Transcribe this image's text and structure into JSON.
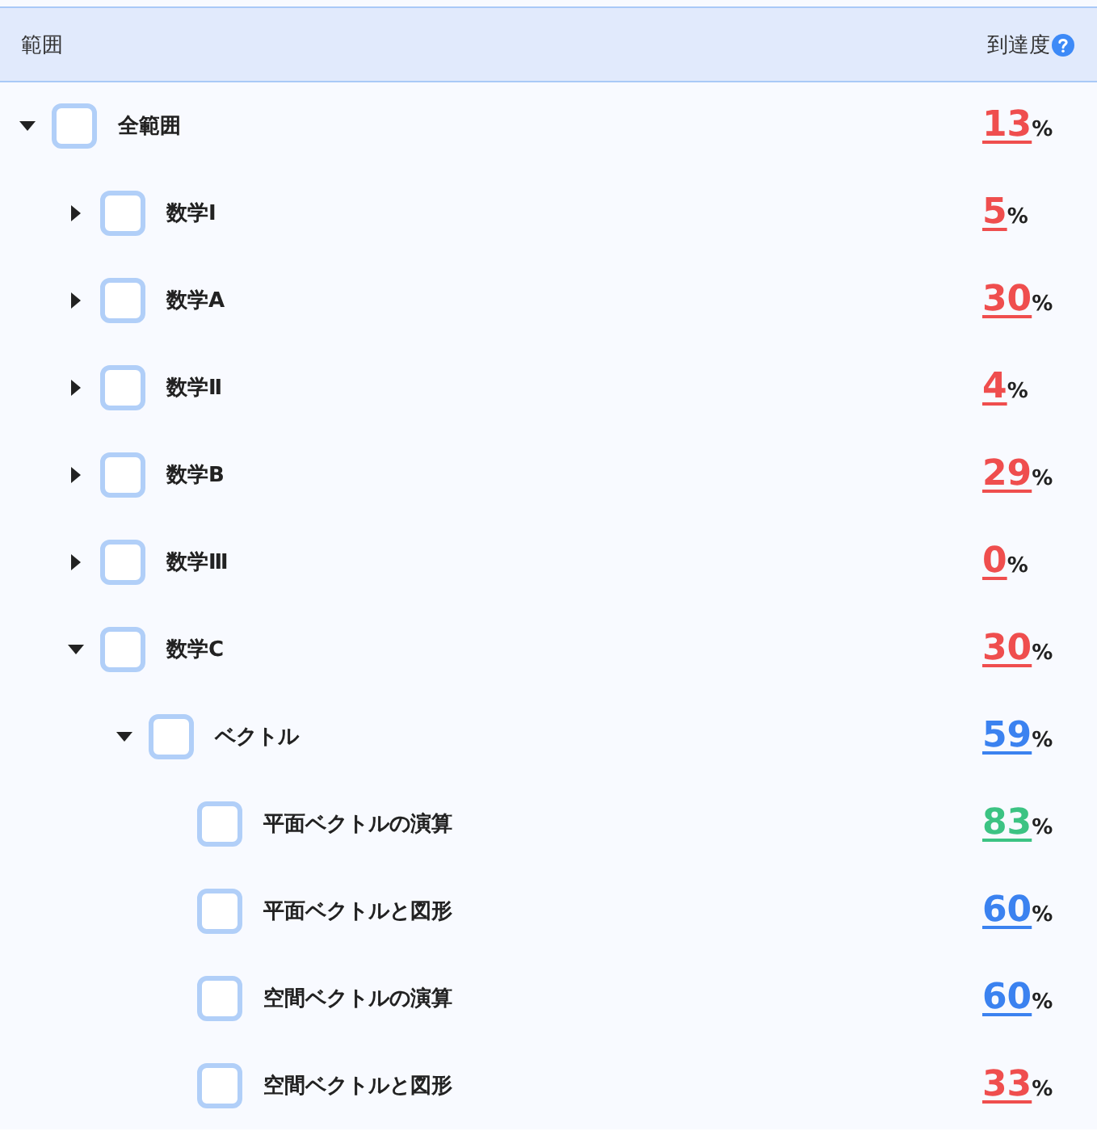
{
  "header": {
    "range_label": "範囲",
    "progress_label": "到達度"
  },
  "tree": [
    {
      "label": "全範囲",
      "checked": false,
      "expanded": true,
      "value": "13",
      "unit": "%",
      "color": "#ef4e4e",
      "children": [
        {
          "label": "数学Ⅰ",
          "checked": false,
          "expanded": false,
          "value": "5",
          "unit": "%",
          "color": "#ef4e4e"
        },
        {
          "label": "数学A",
          "checked": false,
          "expanded": false,
          "value": "30",
          "unit": "%",
          "color": "#ef4e4e"
        },
        {
          "label": "数学Ⅱ",
          "checked": false,
          "expanded": false,
          "value": "4",
          "unit": "%",
          "color": "#ef4e4e"
        },
        {
          "label": "数学B",
          "checked": false,
          "expanded": false,
          "value": "29",
          "unit": "%",
          "color": "#ef4e4e"
        },
        {
          "label": "数学Ⅲ",
          "checked": false,
          "expanded": false,
          "value": "0",
          "unit": "%",
          "color": "#ef4e4e"
        },
        {
          "label": "数学C",
          "checked": false,
          "expanded": true,
          "value": "30",
          "unit": "%",
          "color": "#ef4e4e",
          "children": [
            {
              "label": "ベクトル",
              "checked": false,
              "expanded": true,
              "value": "59",
              "unit": "%",
              "color": "#3b82f0",
              "children": [
                {
                  "label": "平面ベクトルの演算",
                  "checked": false,
                  "value": "83",
                  "unit": "%",
                  "color": "#3cc383"
                },
                {
                  "label": "平面ベクトルと図形",
                  "checked": false,
                  "value": "60",
                  "unit": "%",
                  "color": "#3b82f0"
                },
                {
                  "label": "空間ベクトルの演算",
                  "checked": false,
                  "value": "60",
                  "unit": "%",
                  "color": "#3b82f0"
                },
                {
                  "label": "空間ベクトルと図形",
                  "checked": false,
                  "value": "33",
                  "unit": "%",
                  "color": "#ef4e4e"
                }
              ]
            }
          ]
        }
      ]
    }
  ]
}
